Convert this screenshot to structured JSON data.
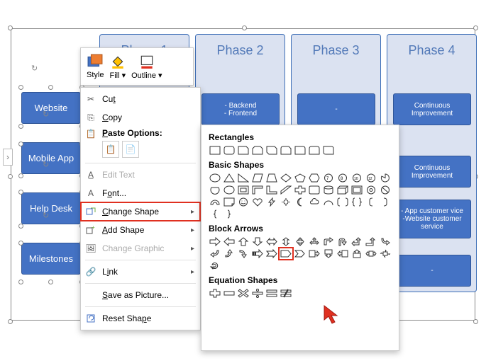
{
  "phases": [
    "Phase 1",
    "Phase 2",
    "Phase 3",
    "Phase 4"
  ],
  "side_items": [
    "Website",
    "Mobile App",
    "Help Desk",
    "Milestones"
  ],
  "boxes": {
    "backend": "- Backend\n- Frontend",
    "dash3": "-",
    "ci1": "Continuous Improvement",
    "ci2": "Continuous Improvement",
    "svc": "- App customer vice\n-Website customer service",
    "dash4": "-"
  },
  "mini": {
    "style": "Style",
    "fill": "Fill",
    "outline": "Outline"
  },
  "menu": {
    "cut": "Cut",
    "copy": "Copy",
    "paste_options": "Paste Options:",
    "edit_text": "Edit Text",
    "font": "Font...",
    "change_shape": "Change Shape",
    "add_shape": "Add Shape",
    "change_graphic": "Change Graphic",
    "link": "Link",
    "save_pic": "Save as Picture...",
    "reset": "Reset Shape"
  },
  "flyout": {
    "rectangles": "Rectangles",
    "basic": "Basic Shapes",
    "block": "Block Arrows",
    "equation": "Equation Shapes"
  }
}
